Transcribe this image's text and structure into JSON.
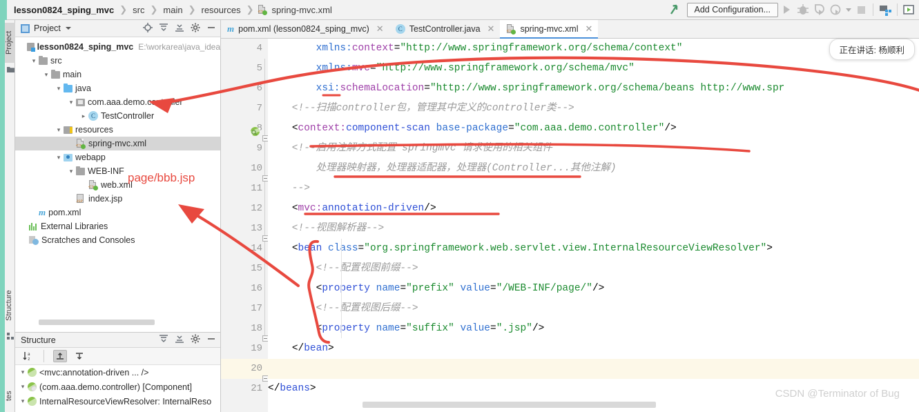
{
  "window": {
    "breadcrumb": [
      {
        "label": "lesson0824_sping_mvc",
        "bold": true,
        "icon": ""
      },
      {
        "label": "src",
        "bold": false,
        "icon": ""
      },
      {
        "label": "main",
        "bold": false,
        "icon": ""
      },
      {
        "label": "resources",
        "bold": false,
        "icon": ""
      },
      {
        "label": "spring-mvc.xml",
        "bold": false,
        "icon": "xml-file-icon"
      }
    ],
    "toolbar": {
      "add_configuration": "Add Configuration...",
      "run_icon": "run-icon",
      "debug_icon": "debug-icon",
      "run_coverage_icon": "run-with-coverage-icon",
      "profile_icon": "profile-icon",
      "stop_icon": "stop-icon",
      "search_everywhere_icon": "search-everywhere-icon",
      "up_arrow_icon": "update-project-icon"
    }
  },
  "left_strip": {
    "tabs": [
      {
        "label": "Project",
        "selected": true,
        "icon": "folder-icon"
      },
      {
        "label": "Structure",
        "selected": false,
        "icon": "structure-icon"
      },
      {
        "label": "tes",
        "selected": false,
        "icon": "favorites-icon"
      }
    ]
  },
  "project_panel": {
    "title": "Project",
    "header_icons": [
      "locate-icon",
      "expand-all-icon",
      "collapse-all-icon",
      "gear-icon",
      "hide-icon"
    ],
    "tree": [
      {
        "indent": 0,
        "twisty": "",
        "icon": "module-icon",
        "label": "lesson0824_sping_mvc",
        "bold": true,
        "sub": "E:\\workarea\\java_idea",
        "selected": false
      },
      {
        "indent": 1,
        "twisty": "v",
        "icon": "folder-icon",
        "label": "src",
        "bold": false,
        "sub": "",
        "selected": false
      },
      {
        "indent": 2,
        "twisty": "v",
        "icon": "folder-icon",
        "label": "main",
        "bold": false,
        "sub": "",
        "selected": false
      },
      {
        "indent": 3,
        "twisty": "v",
        "icon": "source-folder-icon",
        "label": "java",
        "bold": false,
        "sub": "",
        "selected": false
      },
      {
        "indent": 4,
        "twisty": "v",
        "icon": "package-icon",
        "label": "com.aaa.demo.controller",
        "bold": false,
        "sub": "",
        "selected": false
      },
      {
        "indent": 5,
        "twisty": ">",
        "icon": "class-icon",
        "label": "TestController",
        "bold": false,
        "sub": "",
        "selected": false
      },
      {
        "indent": 3,
        "twisty": "v",
        "icon": "resource-folder-icon",
        "label": "resources",
        "bold": false,
        "sub": "",
        "selected": false
      },
      {
        "indent": 4,
        "twisty": "",
        "icon": "xml-file-icon",
        "label": "spring-mvc.xml",
        "bold": false,
        "sub": "",
        "selected": true
      },
      {
        "indent": 3,
        "twisty": "v",
        "icon": "webapp-icon",
        "label": "webapp",
        "bold": false,
        "sub": "",
        "selected": false
      },
      {
        "indent": 4,
        "twisty": "v",
        "icon": "folder-icon",
        "label": "WEB-INF",
        "bold": false,
        "sub": "",
        "selected": false
      },
      {
        "indent": 5,
        "twisty": "",
        "icon": "xml-file-icon",
        "label": "web.xml",
        "bold": false,
        "sub": "",
        "selected": false
      },
      {
        "indent": 4,
        "twisty": "",
        "icon": "jsp-file-icon",
        "label": "index.jsp",
        "bold": false,
        "sub": "",
        "selected": false
      },
      {
        "indent": 1,
        "twisty": "",
        "icon": "maven-icon",
        "label": "pom.xml",
        "bold": false,
        "sub": "",
        "selected": false
      },
      {
        "indent": 0,
        "twisty": "",
        "icon": "libraries-icon",
        "label": "External Libraries",
        "bold": false,
        "sub": "",
        "selected": false
      },
      {
        "indent": 0,
        "twisty": "",
        "icon": "scratches-icon",
        "label": "Scratches and Consoles",
        "bold": false,
        "sub": "",
        "selected": false
      }
    ]
  },
  "structure_panel": {
    "title": "Structure",
    "header_icons": [
      "expand-all-icon",
      "collapse-all-icon",
      "gear-icon",
      "hide-icon"
    ],
    "toolbar_icons": [
      "sort-alphabetically-icon",
      "scroll-from-source-icon",
      "scroll-to-source-icon"
    ],
    "rows": [
      {
        "twisty": "v",
        "icon": "bean-icon",
        "label": "<mvc:annotation-driven ... />"
      },
      {
        "twisty": "v",
        "icon": "bean-component-icon",
        "label": "(com.aaa.demo.controller) [Component]"
      },
      {
        "twisty": "v",
        "icon": "bean-icon",
        "label": "InternalResourceViewResolver: InternalReso"
      }
    ]
  },
  "editor": {
    "tabs": [
      {
        "label": "pom.xml (lesson0824_sping_mvc)",
        "icon": "maven-icon",
        "active": false,
        "closable": true
      },
      {
        "label": "TestController.java",
        "icon": "class-icon",
        "active": false,
        "closable": true
      },
      {
        "label": "spring-mvc.xml",
        "icon": "xml-file-icon",
        "active": true,
        "closable": true
      }
    ],
    "first_visible_line": 4,
    "highlighted_line": 20,
    "lines": [
      {
        "n": 4,
        "fold": "",
        "gutter_icon": "",
        "text": "        xmlns:context=\"http://www.springframework.org/schema/context\""
      },
      {
        "n": 5,
        "fold": "",
        "gutter_icon": "",
        "text": "        xmlns:mvc=\"http://www.springframework.org/schema/mvc\""
      },
      {
        "n": 6,
        "fold": "",
        "gutter_icon": "",
        "text": "        xsi:schemaLocation=\"http://www.springframework.org/schema/beans http://www.spr"
      },
      {
        "n": 7,
        "fold": "",
        "gutter_icon": "",
        "text": "    <!--扫描controller包，管理其中定义的controller类-->"
      },
      {
        "n": 8,
        "fold": "",
        "gutter_icon": "bean-gutter-icon",
        "text": "    <context:component-scan base-package=\"com.aaa.demo.controller\"/>"
      },
      {
        "n": 9,
        "fold": "box",
        "gutter_icon": "",
        "text": "    <!--启用注解方式配置 springmvc 请求使用的相关组件"
      },
      {
        "n": 10,
        "fold": "",
        "gutter_icon": "",
        "text": "        处理器映射器，处理器适配器，处理器(Controller...其他注解)"
      },
      {
        "n": 11,
        "fold": "box",
        "gutter_icon": "",
        "text": "    -->"
      },
      {
        "n": 12,
        "fold": "",
        "gutter_icon": "",
        "text": "    <mvc:annotation-driven/>"
      },
      {
        "n": 13,
        "fold": "",
        "gutter_icon": "",
        "text": "    <!--视图解析器-->"
      },
      {
        "n": 14,
        "fold": "box",
        "gutter_icon": "",
        "text": "    <bean class=\"org.springframework.web.servlet.view.InternalResourceViewResolver\">"
      },
      {
        "n": 15,
        "fold": "",
        "gutter_icon": "",
        "text": "        <!--配置视图前缀-->"
      },
      {
        "n": 16,
        "fold": "",
        "gutter_icon": "",
        "text": "        <property name=\"prefix\" value=\"/WEB-INF/page/\"/>"
      },
      {
        "n": 17,
        "fold": "",
        "gutter_icon": "",
        "text": "        <!--配置视图后缀-->"
      },
      {
        "n": 18,
        "fold": "",
        "gutter_icon": "",
        "text": "        <property name=\"suffix\" value=\".jsp\"/>"
      },
      {
        "n": 19,
        "fold": "box",
        "gutter_icon": "",
        "text": "    </bean>"
      },
      {
        "n": 20,
        "fold": "",
        "gutter_icon": "",
        "text": ""
      },
      {
        "n": 21,
        "fold": "box",
        "gutter_icon": "",
        "text": "</beans>"
      }
    ]
  },
  "toast": {
    "text": "正在讲话: 杨顺利"
  },
  "annotations": {
    "handwritten_text": "page/bbb.jsp",
    "color": "#e8493f"
  },
  "watermark": {
    "text": "CSDN @Terminator of Bug"
  },
  "colors": {
    "accent_teal": "#7fd4bd",
    "annotation_red": "#e8493f",
    "tab_underline_blue": "#4a90d9",
    "selection_gray": "#d6d6d6",
    "current_line_yellow": "#fdf8e8"
  }
}
